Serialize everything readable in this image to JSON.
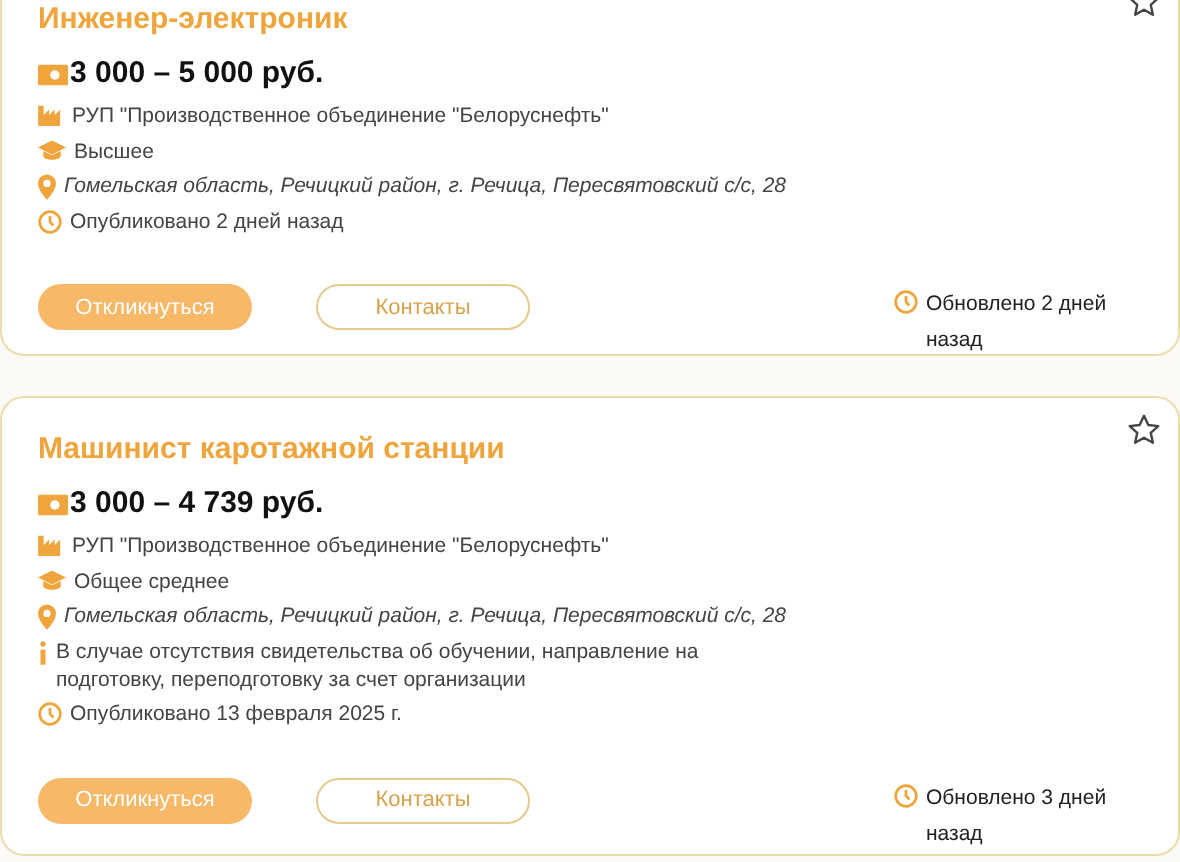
{
  "vacancies": [
    {
      "title": "Инженер-электроник",
      "favorite": false,
      "salary": "3 000 – 5 000 руб.",
      "details": [
        {
          "kind": "company",
          "text": "РУП \"Производственное объединение \"Белоруснефть\""
        },
        {
          "kind": "education",
          "text": "Высшее"
        },
        {
          "kind": "location",
          "text": "Гомельская область, Речицкий район, г. Речица, Пересвятовский с/с, 28"
        },
        {
          "kind": "published",
          "text": "Опубликовано 2 дней назад"
        }
      ],
      "respond_button": "Откликнуться",
      "contacts_button": "Контакты",
      "updated": "Обновлено 2 дней назад"
    },
    {
      "title": "Машинист каротажной станции",
      "favorite": false,
      "salary": "3 000 – 4 739 руб.",
      "details": [
        {
          "kind": "company",
          "text": "РУП \"Производственное объединение \"Белоруснефть\""
        },
        {
          "kind": "education",
          "text": "Общее среднее"
        },
        {
          "kind": "location",
          "text": "Гомельская область, Речицкий район, г. Речица, Пересвятовский с/с, 28"
        },
        {
          "kind": "info",
          "text": "В случае отсутствия свидетельства об обучении, направление на подготовку, переподготовку за счет организации"
        },
        {
          "kind": "published",
          "text": "Опубликовано 13 февраля 2025 г."
        }
      ],
      "respond_button": "Откликнуться",
      "contacts_button": "Контакты",
      "updated": "Обновлено 3 дней назад"
    }
  ]
}
